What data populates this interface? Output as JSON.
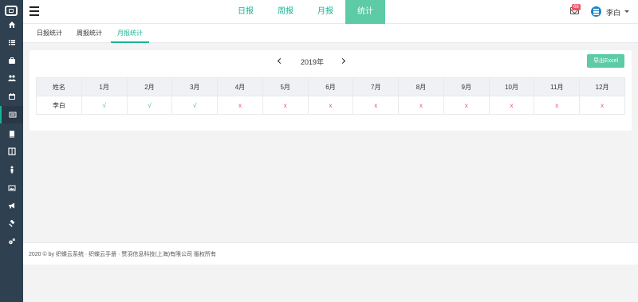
{
  "sidebar": {
    "items": [
      {
        "icon": "home-icon"
      },
      {
        "icon": "list-icon"
      },
      {
        "icon": "briefcase-icon"
      },
      {
        "icon": "users-icon"
      },
      {
        "icon": "calendar-icon"
      },
      {
        "icon": "report-icon",
        "active": true
      },
      {
        "icon": "book-icon"
      },
      {
        "icon": "columns-icon"
      },
      {
        "icon": "person-icon"
      },
      {
        "icon": "image-icon"
      },
      {
        "icon": "bullhorn-icon"
      },
      {
        "icon": "gavel-icon"
      },
      {
        "icon": "settings-icon"
      }
    ]
  },
  "topbar": {
    "tabs": [
      "日报",
      "周报",
      "月报",
      "统计"
    ],
    "active_tab": "统计",
    "mail_badge": "68",
    "username": "李白"
  },
  "subtabs": [
    "日报统计",
    "周报统计",
    "月报统计"
  ],
  "active_subtab": "月报统计",
  "panel": {
    "year": "2019年",
    "export_label": "导出Excel"
  },
  "table": {
    "headers": [
      "姓名",
      "1月",
      "2月",
      "3月",
      "4月",
      "5月",
      "6月",
      "7月",
      "8月",
      "9月",
      "10月",
      "11月",
      "12月"
    ],
    "rows": [
      [
        "李白",
        "√",
        "√",
        "√",
        "x",
        "x",
        "x",
        "x",
        "x",
        "x",
        "x",
        "x",
        "x"
      ]
    ]
  },
  "footer": {
    "text": "2020 © by 织蝶云系统 · 织蝶云手册 · 赞羽信息科技(上海)有限公司 版权所有"
  },
  "colors": {
    "sidebar_bg": "#2f4050",
    "accent": "#1ab394",
    "active_tab_bg": "#5ccba6",
    "error": "#ed5565"
  }
}
